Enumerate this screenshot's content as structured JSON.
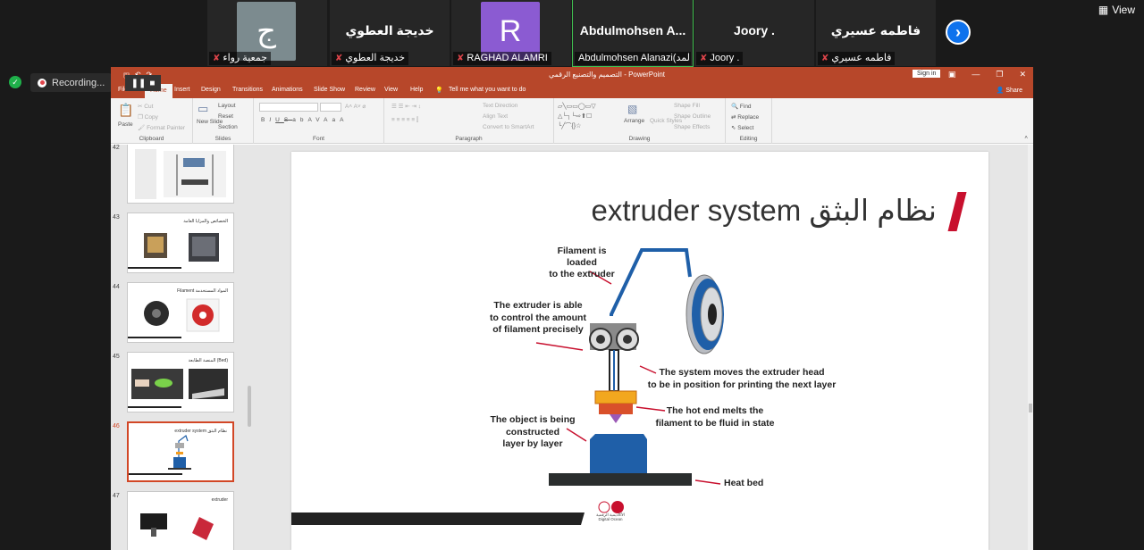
{
  "zoom": {
    "participants": [
      {
        "tile_name": "",
        "avatar_letter": "ج",
        "avatar_color": "#7c8b8f",
        "label": "جمعية رواء"
      },
      {
        "tile_name": "خديجة العطوي",
        "avatar_letter": "",
        "avatar_color": "",
        "label": "خديجة العطوي"
      },
      {
        "tile_name": "",
        "avatar_letter": "R",
        "avatar_color": "#8b5bd2",
        "label": "RAGHAD ALAMRI"
      },
      {
        "tile_name": "Abdulmohsen  A...",
        "avatar_letter": "",
        "avatar_color": "",
        "label": "Abdulmohsen Alanazi(المد..."
      },
      {
        "tile_name": "Joory .",
        "avatar_letter": "",
        "avatar_color": "",
        "label": "Joory ."
      },
      {
        "tile_name": "فاطمه عسيري",
        "avatar_letter": "",
        "avatar_color": "",
        "label": "فاطمه عسيري"
      }
    ],
    "view_label": "View",
    "recording_label": "Recording..."
  },
  "ppt": {
    "window_title": "التصميم والتصنيع الرقمي - PowerPoint",
    "sign_in": "Sign in",
    "tabs": [
      "File",
      "Home",
      "Insert",
      "Design",
      "Transitions",
      "Animations",
      "Slide Show",
      "Review",
      "View",
      "Help"
    ],
    "tell_me": "Tell me what you want to do",
    "share": "Share",
    "ribbon": {
      "clipboard": {
        "paste": "Paste",
        "cut": "Cut",
        "copy": "Copy",
        "format_painter": "Format Painter",
        "name": "Clipboard"
      },
      "slides": {
        "new_slide": "New Slide",
        "layout": "Layout",
        "reset": "Reset",
        "section": "Section",
        "name": "Slides"
      },
      "font": {
        "name": "Font",
        "buttons": [
          "B",
          "I",
          "U",
          "S",
          "ab",
          "AV",
          "Aa",
          "A"
        ]
      },
      "paragraph": {
        "text_direction": "Text Direction",
        "align_text": "Align Text",
        "convert": "Convert to SmartArt",
        "name": "Paragraph"
      },
      "drawing": {
        "arrange": "Arrange",
        "quick_styles": "Quick Styles",
        "shape_fill": "Shape Fill",
        "shape_outline": "Shape Outline",
        "shape_effects": "Shape Effects",
        "name": "Drawing"
      },
      "editing": {
        "find": "Find",
        "replace": "Replace",
        "select": "Select",
        "name": "Editing"
      }
    },
    "thumbnails": [
      {
        "num": "42",
        "title": ""
      },
      {
        "num": "43",
        "title": "الخصائص والمزايا العامة"
      },
      {
        "num": "44",
        "title": "Filament المواد المستخدمة"
      },
      {
        "num": "45",
        "title": "المنصة الطابعة (Bed)"
      },
      {
        "num": "46",
        "title": "extruder system نظام البثق"
      },
      {
        "num": "47",
        "title": "extruder"
      }
    ],
    "slide": {
      "title": "extruder system نظام البثق",
      "labels": {
        "filament": [
          "Filament is loaded",
          "to the extruder"
        ],
        "extruder": [
          "The extruder is able",
          "to control the amount",
          "of filament precisely"
        ],
        "system": [
          "The system moves the extruder head",
          "to be in position for printing the next layer"
        ],
        "hotend": [
          "The hot end melts the",
          "filament to be fluid in state"
        ],
        "object": [
          "The object is being",
          "constructed",
          "layer by layer"
        ],
        "bed": "Heat bed"
      },
      "logo_text": [
        "الأكاديمية الرقمية",
        "Digital Ocean"
      ]
    }
  }
}
